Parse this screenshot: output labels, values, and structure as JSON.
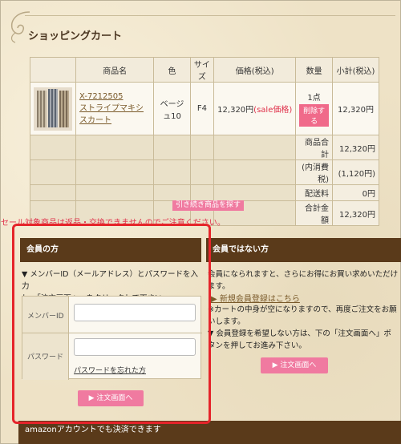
{
  "page": {
    "title": "ショッピングカート"
  },
  "cart": {
    "headers": [
      "商品名",
      "色",
      "サイズ",
      "価格(税込)",
      "数量",
      "小計(税込)"
    ],
    "item": {
      "code": "X-7212505",
      "name": "ストライプマキシスカート",
      "color": "ベージュ10",
      "size": "F4",
      "price": "12,320円",
      "sale_label": "(sale価格)",
      "quantity": "1点",
      "delete_label": "削除する",
      "subtotal": "12,320円"
    },
    "summary": [
      {
        "label": "商品合計",
        "value": "12,320円"
      },
      {
        "label": "(内消費税)",
        "value": "(1,120円)"
      },
      {
        "label": "配送料",
        "value": "0円"
      },
      {
        "label": "合計金額",
        "value": "12,320円"
      }
    ],
    "continue_label": "引き続き商品を探す",
    "warning": "セール対象商品は返品・交換できませんのでご注意ください。"
  },
  "member": {
    "heading": "会員の方",
    "desc_line1": "▼ メンバーID（メールアドレス）とパスワードを入力",
    "desc_line2": "し、「注文画面へ」をクリックして下さい。",
    "id_label": "メンバーID",
    "password_label": "パスワード",
    "id_value": "",
    "password_value": "",
    "forgot_label": "パスワードを忘れた方",
    "order_button": "▶ 注文画面へ"
  },
  "guest": {
    "heading": "会員ではない方",
    "desc_line1": "会員になられますと、さらにお得にお買い求めいただけ",
    "desc_line2": "ます。",
    "register_link": "▶ 新規会員登録はこちら",
    "note_line1": "※カートの中身が空になりますので、再度ご注文をお願",
    "note_line2": "いします。",
    "note_line3": "▼ 会員登録を希望しない方は、下の「注文画面へ」ボ",
    "note_line4": "タンを押してお進み下さい。",
    "order_button": "▶ 注文画面へ"
  },
  "amazon": {
    "label": "amazonアカウントでも決済できます"
  },
  "colors": {
    "header_brown": "#5a3a1a",
    "sale_red": "#e0314b",
    "button_pink": "#f07aa0",
    "highlight_red": "#e5242a"
  }
}
